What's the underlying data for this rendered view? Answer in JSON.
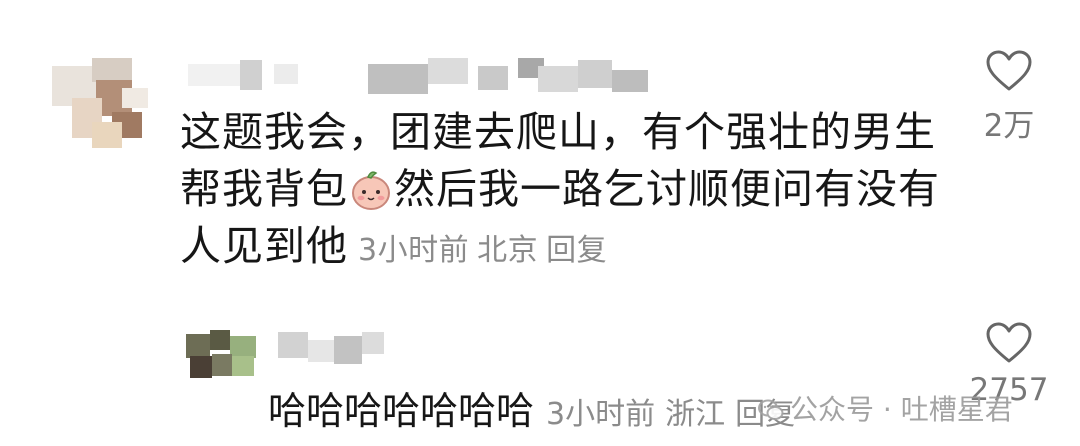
{
  "comment": {
    "text_part1": "这题我会，团建去爬山，有个强壮的男生帮我背包",
    "text_part2": "然后我一路乞讨顺便问有没有人见到他",
    "emoji": "peach-face-emoji",
    "time": "3小时前",
    "location": "北京",
    "reply_label": "回复",
    "like_count": "2万"
  },
  "reply": {
    "text": "哈哈哈哈哈哈哈",
    "time": "3小时前",
    "location": "浙江",
    "reply_label": "回复",
    "like_count": "2757"
  },
  "watermark": {
    "text": "公众号 · 吐槽星君"
  },
  "colors": {
    "text": "#161616",
    "meta": "#8b8b8b",
    "icon": "#666666"
  }
}
